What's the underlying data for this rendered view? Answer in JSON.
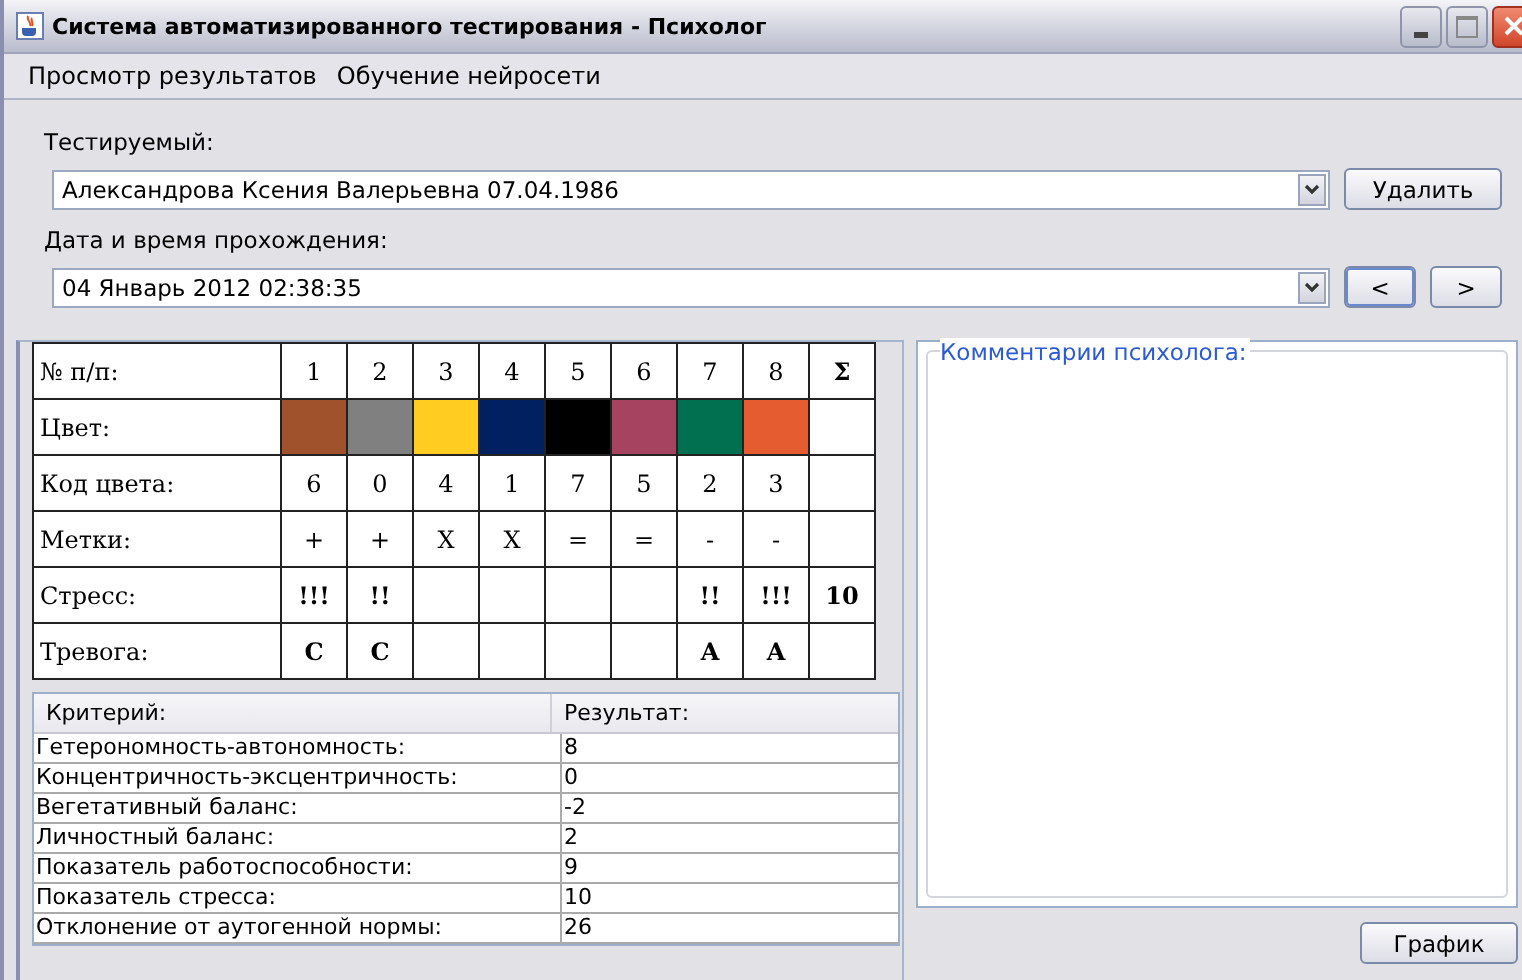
{
  "window": {
    "title": "Система автоматизированного тестирования - Психолог"
  },
  "menu": [
    {
      "label": "Просмотр результатов"
    },
    {
      "label": "Обучение нейросети"
    }
  ],
  "subject": {
    "label": "Тестируемый:",
    "value": "Александрова Ксения Валерьевна 07.04.1986",
    "button": "Удалить"
  },
  "session": {
    "label": "Дата и время прохождения:",
    "value": "04 Январь 2012 02:38:35",
    "prev_button": "<",
    "next_button": ">"
  },
  "grid": {
    "header": [
      "№ п/п:",
      "1",
      "2",
      "3",
      "4",
      "5",
      "6",
      "7",
      "8",
      "Σ"
    ],
    "rows": [
      {
        "kind": "color",
        "label": "Цвет:",
        "cells": [
          {
            "color": "#a0522d"
          },
          {
            "color": "#808080"
          },
          {
            "color": "#ffcc22"
          },
          {
            "color": "#002060"
          },
          {
            "color": "#000000"
          },
          {
            "color": "#a64360"
          },
          {
            "color": "#007050"
          },
          {
            "color": "#e55c30"
          },
          {}
        ]
      },
      {
        "kind": "text",
        "label": "Код цвета:",
        "cells": [
          "6",
          "0",
          "4",
          "1",
          "7",
          "5",
          "2",
          "3",
          ""
        ]
      },
      {
        "kind": "text",
        "label": "Метки:",
        "cells": [
          "+",
          "+",
          "X",
          "X",
          "=",
          "=",
          "-",
          "-",
          ""
        ]
      },
      {
        "kind": "bold",
        "label": "Стресс:",
        "cells": [
          "!!!",
          "!!",
          "",
          "",
          "",
          "",
          "!!",
          "!!!",
          "10"
        ]
      },
      {
        "kind": "bold",
        "label": "Тревога:",
        "cells": [
          "C",
          "C",
          "",
          "",
          "",
          "",
          "A",
          "A",
          ""
        ]
      }
    ]
  },
  "results": {
    "columns": [
      "Критерий:",
      "Результат:"
    ],
    "rows": [
      [
        "Гетерономность-автономность:",
        "8"
      ],
      [
        "Концентричность-эксцентричность:",
        "0"
      ],
      [
        "Вегетативный баланс:",
        "-2"
      ],
      [
        "Личностный баланс:",
        "2"
      ],
      [
        "Показатель работоспособности:",
        "9"
      ],
      [
        "Показатель стресса:",
        "10"
      ],
      [
        "Отклонение от аутогенной нормы:",
        "26"
      ]
    ]
  },
  "comments": {
    "title": "Комментарии психолога:"
  },
  "chart_button": "График"
}
